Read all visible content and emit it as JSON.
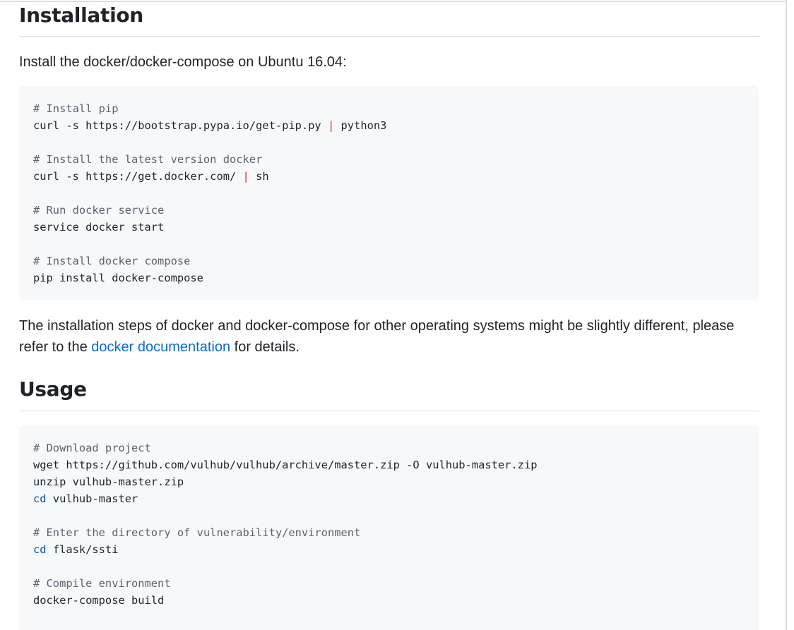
{
  "installation": {
    "heading": "Installation",
    "intro": "Install the docker/docker-compose on Ubuntu 16.04:",
    "code": {
      "c1": "# Install pip",
      "l1a": "curl -s https://bootstrap.pypa.io/get-pip.py ",
      "pipe": "|",
      "l1b": " python3",
      "c2": "# Install the latest version docker",
      "l2a": "curl -s https://get.docker.com/ ",
      "l2b": " sh",
      "c3": "# Run docker service",
      "l3": "service docker start",
      "c4": "# Install docker compose",
      "l4": "pip install docker-compose"
    },
    "note_before_link": "The installation steps of docker and docker-compose for other operating systems might be slightly different, please refer to the ",
    "link_text": "docker documentation",
    "note_after_link": " for details."
  },
  "usage": {
    "heading": "Usage",
    "code": {
      "c1": "# Download project",
      "l1": "wget https://github.com/vulhub/vulhub/archive/master.zip -O vulhub-master.zip",
      "l2": "unzip vulhub-master.zip",
      "cd": "cd",
      "l3rest": " vulhub-master",
      "c2": "# Enter the directory of vulnerability/environment",
      "l4rest": " flask/ssti",
      "c3": "# Compile environment",
      "l5": "docker-compose build"
    }
  },
  "colors": {
    "link": "#0969da",
    "comment": "#59636e",
    "pipe": "#cf222e",
    "keyword": "#0550ae",
    "code_bg": "#f6f8fa"
  }
}
